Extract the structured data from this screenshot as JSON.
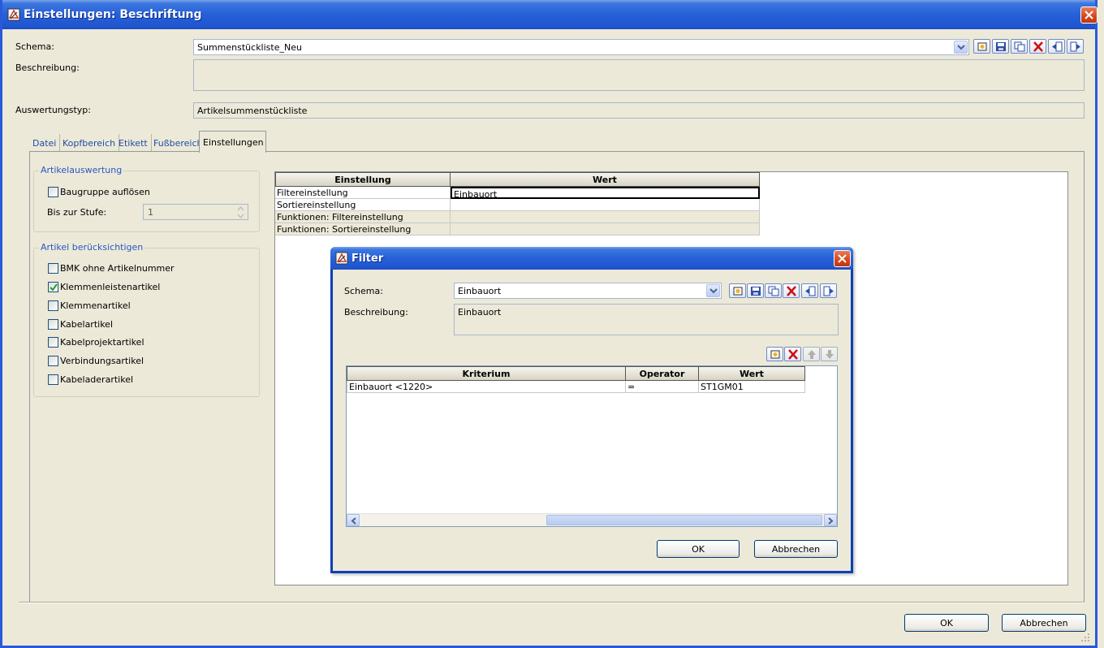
{
  "window": {
    "title": "Einstellungen: Beschriftung",
    "schema_label": "Schema:",
    "schema_value": "Summenstückliste_Neu",
    "beschreibung_label": "Beschreibung:",
    "beschreibung_value": "",
    "auswertungstyp_label": "Auswertungstyp:",
    "auswertungstyp_value": "Artikelsummenstückliste",
    "ok_label": "OK",
    "cancel_label": "Abbrechen"
  },
  "tabs": [
    {
      "label": "Datei"
    },
    {
      "label": "Kopfbereich"
    },
    {
      "label": "Etikett"
    },
    {
      "label": "Fußbereich"
    },
    {
      "label": "Einstellungen"
    }
  ],
  "group_artikelauswertung": {
    "title": "Artikelauswertung",
    "baugruppe_label": "Baugruppe auflösen",
    "baugruppe_checked": false,
    "stufe_label": "Bis zur Stufe:",
    "stufe_value": "1"
  },
  "group_artikel": {
    "title": "Artikel berücksichtigen",
    "items": [
      {
        "label": "BMK ohne Artikelnummer",
        "checked": false
      },
      {
        "label": "Klemmenleistenartikel",
        "checked": true
      },
      {
        "label": "Klemmenartikel",
        "checked": false
      },
      {
        "label": "Kabelartikel",
        "checked": false
      },
      {
        "label": "Kabelprojektartikel",
        "checked": false
      },
      {
        "label": "Verbindungsartikel",
        "checked": false
      },
      {
        "label": "Kabeladerartikel",
        "checked": false
      }
    ]
  },
  "settings_table": {
    "headers": [
      "Einstellung",
      "Wert"
    ],
    "rows": [
      {
        "name": "Filtereinstellung",
        "value": "Einbauort"
      },
      {
        "name": "Sortiereinstellung",
        "value": ""
      },
      {
        "name": "Funktionen: Filtereinstellung",
        "value": ""
      },
      {
        "name": "Funktionen: Sortiereinstellung",
        "value": ""
      }
    ]
  },
  "filter_dialog": {
    "title": "Filter",
    "schema_label": "Schema:",
    "schema_value": "Einbauort",
    "beschreibung_label": "Beschreibung:",
    "beschreibung_value": "Einbauort",
    "headers": [
      "Kriterium",
      "Operator",
      "Wert"
    ],
    "rows": [
      {
        "kriterium": "Einbauort <1220>",
        "operator": "=",
        "wert": "ST1GM01"
      }
    ],
    "ok_label": "OK",
    "cancel_label": "Abbrechen"
  },
  "colors": {
    "titlebar": "#2660d8",
    "close": "#d3471c",
    "tab_link": "#1f4ea5",
    "group_title": "#2a56c6",
    "window_bg": "#ece9d8"
  },
  "icons": [
    "app-icon",
    "close-icon",
    "dropdown-arrow-icon",
    "new-icon",
    "save-icon",
    "copy-icon",
    "delete-icon",
    "import-icon",
    "export-icon",
    "move-up-icon",
    "move-down-icon",
    "checkmark-icon",
    "scroll-left-icon",
    "scroll-right-icon",
    "resize-grip-icon"
  ]
}
